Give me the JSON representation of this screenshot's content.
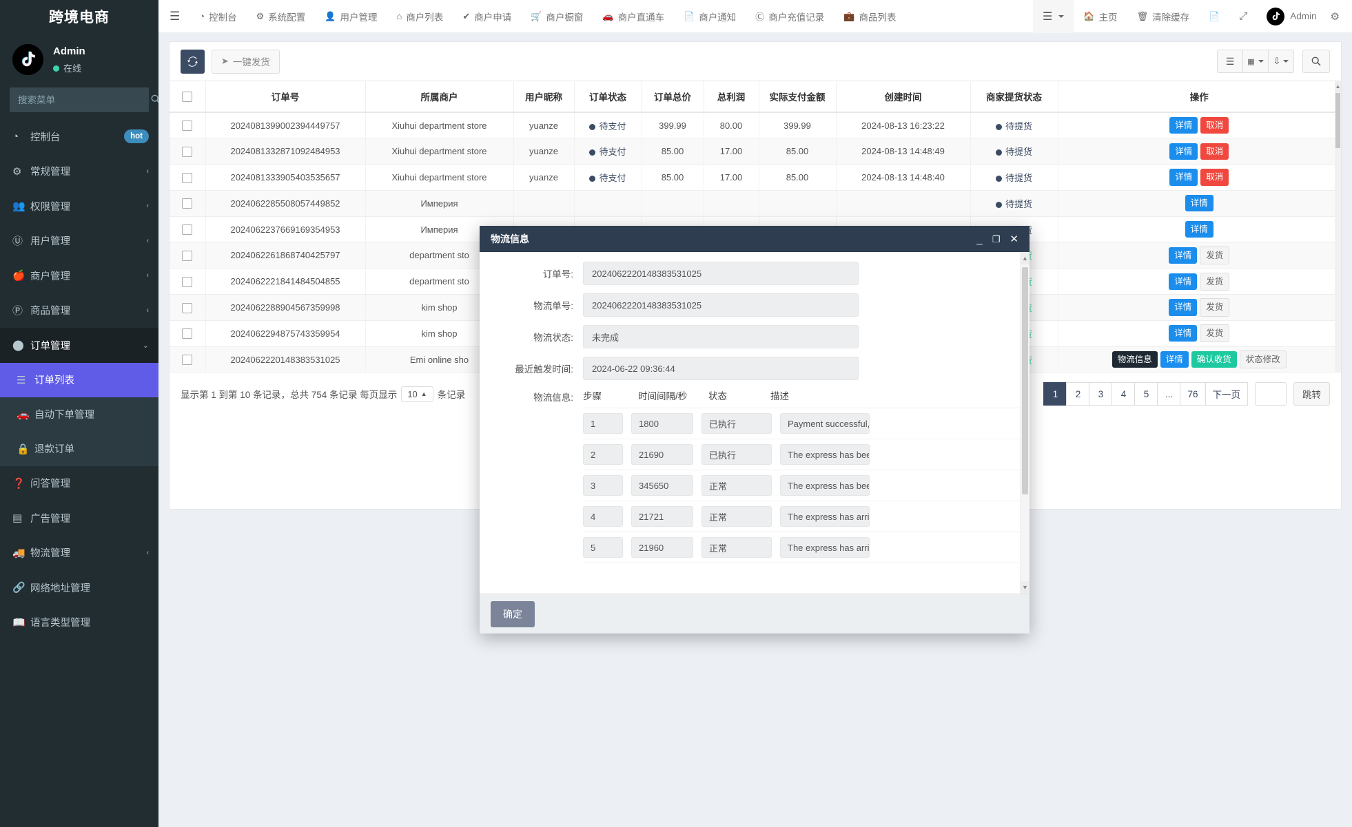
{
  "sidebar": {
    "brand": "跨境电商",
    "user": {
      "name": "Admin",
      "status": "在线"
    },
    "search_placeholder": "搜索菜单",
    "items": [
      {
        "label": "控制台",
        "icon": "dashboard-icon",
        "badge": "hot",
        "arrow": ""
      },
      {
        "label": "常规管理",
        "icon": "gears-icon",
        "badge": "",
        "arrow": "‹"
      },
      {
        "label": "权限管理",
        "icon": "users-icon",
        "badge": "",
        "arrow": "‹"
      },
      {
        "label": "用户管理",
        "icon": "user-circle-icon",
        "badge": "",
        "arrow": "‹"
      },
      {
        "label": "商户管理",
        "icon": "apple-icon",
        "badge": "",
        "arrow": "‹"
      },
      {
        "label": "商品管理",
        "icon": "product-icon",
        "badge": "",
        "arrow": "‹"
      },
      {
        "label": "订单管理",
        "icon": "box-icon",
        "badge": "",
        "arrow": "⌄"
      },
      {
        "label": "订单列表",
        "icon": "list-icon",
        "badge": "",
        "arrow": "",
        "sub": true,
        "active": true
      },
      {
        "label": "自动下单管理",
        "icon": "car-icon",
        "badge": "",
        "arrow": "",
        "sub": true
      },
      {
        "label": "退款订单",
        "icon": "lock-icon",
        "badge": "",
        "arrow": "",
        "sub": true
      },
      {
        "label": "问答管理",
        "icon": "question-icon",
        "badge": "",
        "arrow": ""
      },
      {
        "label": "广告管理",
        "icon": "ad-icon",
        "badge": "",
        "arrow": ""
      },
      {
        "label": "物流管理",
        "icon": "truck-icon",
        "badge": "",
        "arrow": "‹"
      },
      {
        "label": "网络地址管理",
        "icon": "link-icon",
        "badge": "",
        "arrow": ""
      },
      {
        "label": "语言类型管理",
        "icon": "language-icon",
        "badge": "",
        "arrow": ""
      }
    ]
  },
  "topnav": {
    "links": [
      {
        "label": "控制台",
        "icon": "dashboard-icon"
      },
      {
        "label": "系统配置",
        "icon": "gear-icon"
      },
      {
        "label": "用户管理",
        "icon": "user-icon"
      },
      {
        "label": "商户列表",
        "icon": "home-icon"
      },
      {
        "label": "商户申请",
        "icon": "check-circle-icon"
      },
      {
        "label": "商户橱窗",
        "icon": "cart-icon"
      },
      {
        "label": "商户直通车",
        "icon": "car-icon"
      },
      {
        "label": "商户通知",
        "icon": "note-icon"
      },
      {
        "label": "商户充值记录",
        "icon": "money-icon"
      },
      {
        "label": "商品列表",
        "icon": "bag-icon"
      }
    ],
    "right": {
      "menu_icon": "hamburger-icon",
      "home_label": "主页",
      "clear_cache_label": "清除缓存",
      "note_icon": "note-icon",
      "fullscreen_icon": "fullscreen-icon",
      "admin_label": "Admin",
      "gear_icon": "gear-icon"
    }
  },
  "toolbar": {
    "refresh_icon": "refresh-icon",
    "oneclick_ship_label": "一键发货",
    "oneclick_ship_icon": "send-icon",
    "columns_icon": "columns-icon",
    "grid_icon": "grid-icon",
    "export_icon": "export-icon",
    "search_icon": "search-icon"
  },
  "table": {
    "headers": [
      "",
      "订单号",
      "所属商户",
      "用户昵称",
      "订单状态",
      "订单总价",
      "总利润",
      "实际支付金额",
      "创建时间",
      "商家提货状态",
      "操作"
    ],
    "rows": [
      {
        "order_no": "2024081399002394449757",
        "merchant": "Xiuhui department store",
        "nickname": "yuanze",
        "order_status": "待支付",
        "order_status_type": "wait",
        "total": "399.99",
        "profit": "80.00",
        "paid": "399.99",
        "created": "2024-08-13 16:23:22",
        "pickup_status": "待提货",
        "pickup_type": "wait",
        "actions": [
          {
            "label": "详情",
            "style": "a-blue"
          },
          {
            "label": "取消",
            "style": "a-red"
          }
        ]
      },
      {
        "order_no": "2024081332871092484953",
        "merchant": "Xiuhui department store",
        "nickname": "yuanze",
        "order_status": "待支付",
        "order_status_type": "wait",
        "total": "85.00",
        "profit": "17.00",
        "paid": "85.00",
        "created": "2024-08-13 14:48:49",
        "pickup_status": "待提货",
        "pickup_type": "wait",
        "actions": [
          {
            "label": "详情",
            "style": "a-blue"
          },
          {
            "label": "取消",
            "style": "a-red"
          }
        ]
      },
      {
        "order_no": "2024081333905403535657",
        "merchant": "Xiuhui department store",
        "nickname": "yuanze",
        "order_status": "待支付",
        "order_status_type": "wait",
        "total": "85.00",
        "profit": "17.00",
        "paid": "85.00",
        "created": "2024-08-13 14:48:40",
        "pickup_status": "待提货",
        "pickup_type": "wait",
        "actions": [
          {
            "label": "详情",
            "style": "a-blue"
          },
          {
            "label": "取消",
            "style": "a-red"
          }
        ]
      },
      {
        "order_no": "2024062285508057449852",
        "merchant": "Империя",
        "nickname": "",
        "order_status": "",
        "order_status_type": "",
        "total": "",
        "profit": "",
        "paid": "",
        "created": "",
        "pickup_status": "待提货",
        "pickup_type": "wait",
        "actions": [
          {
            "label": "详情",
            "style": "a-blue"
          }
        ]
      },
      {
        "order_no": "2024062237669169354953",
        "merchant": "Империя",
        "nickname": "",
        "order_status": "",
        "order_status_type": "",
        "total": "",
        "profit": "",
        "paid": "",
        "created": "",
        "pickup_status": "待提货",
        "pickup_type": "wait",
        "actions": [
          {
            "label": "详情",
            "style": "a-blue"
          }
        ]
      },
      {
        "order_no": "2024062261868740425797",
        "merchant": "department sto",
        "nickname": "",
        "order_status": "",
        "order_status_type": "",
        "total": "",
        "profit": "",
        "paid": "",
        "created": "",
        "pickup_status": "已提货",
        "pickup_type": "done",
        "actions": [
          {
            "label": "详情",
            "style": "a-blue"
          },
          {
            "label": "发货",
            "style": "a-grey"
          }
        ]
      },
      {
        "order_no": "2024062221841484504855",
        "merchant": "department sto",
        "nickname": "",
        "order_status": "",
        "order_status_type": "",
        "total": "",
        "profit": "",
        "paid": "",
        "created": "",
        "pickup_status": "已提货",
        "pickup_type": "done",
        "actions": [
          {
            "label": "详情",
            "style": "a-blue"
          },
          {
            "label": "发货",
            "style": "a-grey"
          }
        ]
      },
      {
        "order_no": "2024062288904567359998",
        "merchant": "kim shop",
        "nickname": "",
        "order_status": "",
        "order_status_type": "",
        "total": "",
        "profit": "",
        "paid": "",
        "created": "",
        "pickup_status": "已提货",
        "pickup_type": "done",
        "actions": [
          {
            "label": "详情",
            "style": "a-blue"
          },
          {
            "label": "发货",
            "style": "a-grey"
          }
        ]
      },
      {
        "order_no": "2024062294875743359954",
        "merchant": "kim shop",
        "nickname": "",
        "order_status": "",
        "order_status_type": "",
        "total": "",
        "profit": "",
        "paid": "",
        "created": "",
        "pickup_status": "已提货",
        "pickup_type": "done",
        "actions": [
          {
            "label": "详情",
            "style": "a-blue"
          },
          {
            "label": "发货",
            "style": "a-grey"
          }
        ]
      },
      {
        "order_no": "2024062220148383531025",
        "merchant": "Emi online sho",
        "nickname": "",
        "order_status": "",
        "order_status_type": "",
        "total": "",
        "profit": "",
        "paid": "",
        "created": "",
        "pickup_status": "已提货",
        "pickup_type": "done",
        "actions": [
          {
            "label": "物流信息",
            "style": "a-dark"
          },
          {
            "label": "详情",
            "style": "a-blue"
          },
          {
            "label": "确认收货",
            "style": "a-green"
          },
          {
            "label": "状态修改",
            "style": "a-grey"
          }
        ]
      }
    ]
  },
  "pagination": {
    "summary_prefix": "显示第 1 到第 10 条记录，总共 754 条记录 每页显示",
    "per_page": "10",
    "summary_suffix": "条记录",
    "pages": [
      "1",
      "2",
      "3",
      "4",
      "5",
      "...",
      "76"
    ],
    "active_page": "1",
    "next_label": "下一页",
    "jump_label": "跳转",
    "jump_value": ""
  },
  "modal": {
    "title": "物流信息",
    "minimize_icon": "minimize-icon",
    "maximize_icon": "maximize-icon",
    "close_icon": "close-icon",
    "fields": [
      {
        "label": "订单号:",
        "value": "2024062220148383531025"
      },
      {
        "label": "物流单号:",
        "value": "2024062220148383531025"
      },
      {
        "label": "物流状态:",
        "value": "未完成"
      },
      {
        "label": "最近触发时间:",
        "value": "2024-06-22 09:36:44"
      }
    ],
    "logistics_label": "物流信息:",
    "log_headers": [
      "步骤",
      "时间间隔/秒",
      "状态",
      "描述"
    ],
    "log_rows": [
      {
        "step": "1",
        "interval": "1800",
        "status": "已执行",
        "desc": "Payment successful, w"
      },
      {
        "step": "2",
        "interval": "21690",
        "status": "已执行",
        "desc": "The express has been"
      },
      {
        "step": "3",
        "interval": "345650",
        "status": "正常",
        "desc": "The express has been"
      },
      {
        "step": "4",
        "interval": "21721",
        "status": "正常",
        "desc": "The express has arrive"
      },
      {
        "step": "5",
        "interval": "21960",
        "status": "正常",
        "desc": "The express has arrive"
      }
    ],
    "confirm_label": "确定"
  },
  "colors": {
    "sidebar_bg": "#222d32",
    "active_menu": "#605ce7",
    "primary_blue": "#1a8ded",
    "danger_red": "#f0483e",
    "success_green": "#1ec99f",
    "modal_header": "#2e3e50"
  }
}
